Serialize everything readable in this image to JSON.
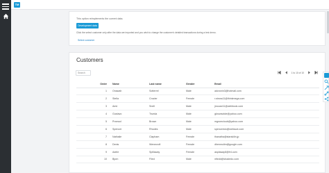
{
  "app": {
    "brand_icon": "app-logo-icon",
    "brand_text": "TM",
    "accent": "#1a9ad6"
  },
  "notice": {
    "line1": "This option reimplements the current data.",
    "button_label": "Development data",
    "line2": "Click the select customer only after the data are imported and you wish to change the customer's detailed transactions during a test demo.",
    "link_label": "Select customer"
  },
  "customers": {
    "title": "Customers",
    "search_placeholder": "Search",
    "pager_text": "1 to 10 of 10",
    "columns": {
      "order": "Order",
      "name": "Name",
      "last": "Last name",
      "gender": "Gender",
      "email": "Email"
    },
    "rows": [
      {
        "order": "1",
        "name": "Onawah",
        "last": "Sotterrel",
        "gender": "Male",
        "email": "adcronin3@hotmail.com"
      },
      {
        "order": "2",
        "name": "Stella",
        "last": "Crozier",
        "gender": "Female",
        "email": "r.stross11@thinkmega.com"
      },
      {
        "order": "3",
        "name": "Amir",
        "last": "Snell",
        "gender": "Male",
        "email": "jmouse11@webbook.com"
      },
      {
        "order": "4",
        "name": "Gustavo",
        "last": "Trueda",
        "gender": "Male",
        "email": "gkrowsotde@yahoo.com"
      },
      {
        "order": "5",
        "name": "Pramod",
        "last": "Brown",
        "gender": "Male",
        "email": "mgromcloub@yahoo.com"
      },
      {
        "order": "6",
        "name": "Spencer",
        "last": "Rhodes",
        "gender": "Male",
        "email": "spencersto@webscot.com"
      },
      {
        "order": "7",
        "name": "Nathalie",
        "last": "Clapham",
        "gender": "Female",
        "email": "thanatha@starskilin.jp"
      },
      {
        "order": "8",
        "name": "Denis",
        "last": "Wenecroft",
        "gender": "Female",
        "email": "dhenmolim@google.com"
      },
      {
        "order": "9",
        "name": "Adele",
        "last": "Spillaway",
        "gender": "Female",
        "email": "asplaway8@fr4.com"
      },
      {
        "order": "10",
        "name": "Bjorn",
        "last": "Filed",
        "gender": "Male",
        "email": "nfiedd@shadedo.com"
      }
    ]
  }
}
